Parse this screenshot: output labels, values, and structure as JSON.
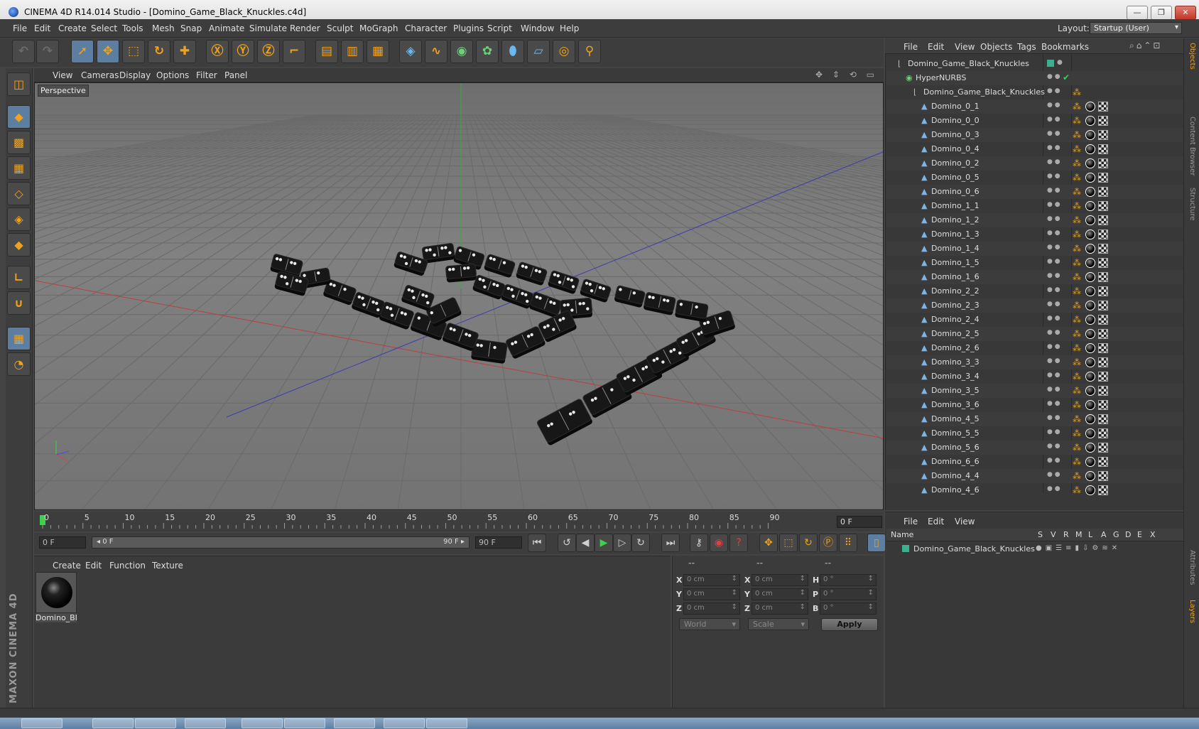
{
  "window": {
    "title": "CINEMA 4D R14.014 Studio - [Domino_Game_Black_Knuckles.c4d]",
    "minimize": "—",
    "maximize": "❐",
    "close": "✕"
  },
  "menu": [
    "File",
    "Edit",
    "Create",
    "Select",
    "Tools",
    "Mesh",
    "Snap",
    "Animate",
    "Simulate",
    "Render",
    "Sculpt",
    "MoGraph",
    "Character",
    "Plugins",
    "Script",
    "Window",
    "Help"
  ],
  "layout": {
    "label": "Layout:",
    "value": "Startup (User)"
  },
  "toolbar": [
    {
      "name": "undo",
      "icon": "undo-icon",
      "glyph": "↶"
    },
    {
      "name": "redo",
      "icon": "redo-icon",
      "glyph": "↷"
    },
    {
      "name": "live-selection",
      "icon": "cursor-icon",
      "glyph": "➚"
    },
    {
      "name": "move",
      "icon": "move-icon",
      "glyph": "✥"
    },
    {
      "name": "scale",
      "icon": "scale-icon",
      "glyph": "⬚"
    },
    {
      "name": "rotate",
      "icon": "rotate-icon",
      "glyph": "↻"
    },
    {
      "name": "create-object",
      "icon": "plus-icon",
      "glyph": "✚"
    },
    {
      "name": "x-axis",
      "icon": "x-axis-icon",
      "glyph": "Ⓧ"
    },
    {
      "name": "y-axis",
      "icon": "y-axis-icon",
      "glyph": "Ⓨ"
    },
    {
      "name": "z-axis",
      "icon": "z-axis-icon",
      "glyph": "Ⓩ"
    },
    {
      "name": "coordinate-system",
      "icon": "coords-icon",
      "glyph": "⌐"
    },
    {
      "name": "render-view",
      "icon": "clapper-icon",
      "glyph": "▤"
    },
    {
      "name": "render-picture-viewer",
      "icon": "clapper-play-icon",
      "glyph": "▥"
    },
    {
      "name": "render-settings",
      "icon": "clapper-gear-icon",
      "glyph": "▦"
    },
    {
      "name": "cube",
      "icon": "cube-icon",
      "glyph": "◈"
    },
    {
      "name": "spline",
      "icon": "spline-icon",
      "glyph": "∿"
    },
    {
      "name": "nurbs",
      "icon": "nurbs-icon",
      "glyph": "◉"
    },
    {
      "name": "array",
      "icon": "mograph-icon",
      "glyph": "✿"
    },
    {
      "name": "deformer",
      "icon": "deformer-icon",
      "glyph": "⬮"
    },
    {
      "name": "floor",
      "icon": "floor-icon",
      "glyph": "▱"
    },
    {
      "name": "camera",
      "icon": "camera-icon",
      "glyph": "◎"
    },
    {
      "name": "light",
      "icon": "light-icon",
      "glyph": "⚲"
    }
  ],
  "lefttools": [
    {
      "name": "make-editable",
      "icon": "make-editable-icon",
      "glyph": "◫"
    },
    {
      "name": "model-mode",
      "icon": "model-icon",
      "glyph": "◆"
    },
    {
      "name": "texture-mode",
      "icon": "checker-icon",
      "glyph": "▩"
    },
    {
      "name": "workplane",
      "icon": "workplane-icon",
      "glyph": "▦"
    },
    {
      "name": "points-mode",
      "icon": "points-icon",
      "glyph": "◇"
    },
    {
      "name": "edges-mode",
      "icon": "edges-icon",
      "glyph": "◈"
    },
    {
      "name": "polygons-mode",
      "icon": "polygons-icon",
      "glyph": "◆"
    },
    {
      "name": "axis-mode",
      "icon": "axis-icon",
      "glyph": "∟"
    },
    {
      "name": "magnet",
      "icon": "magnet-icon",
      "glyph": "∪"
    },
    {
      "name": "grid-lock",
      "icon": "grid-lock-icon",
      "glyph": "▦"
    },
    {
      "name": "snap",
      "icon": "snap-icon",
      "glyph": "◔"
    }
  ],
  "brand": "MAXON CINEMA 4D",
  "viewport": {
    "menu": [
      "View",
      "Cameras",
      "Display",
      "Options",
      "Filter",
      "Panel"
    ],
    "label": "Perspective",
    "nav_icons": "✥ ⇕ ⟲ ▭"
  },
  "timeline": {
    "ticks": [
      "0",
      "5",
      "10",
      "15",
      "20",
      "25",
      "30",
      "35",
      "40",
      "45",
      "50",
      "55",
      "60",
      "65",
      "70",
      "75",
      "80",
      "85",
      "90"
    ],
    "frame_display": "0 F"
  },
  "transport": {
    "start": "0 F",
    "slider_left": "◂ 0 F",
    "slider_right": "90 F ▸",
    "end": "90 F",
    "buttons": [
      {
        "name": "go-start",
        "icon": "go-start-icon",
        "glyph": "⏮"
      },
      {
        "name": "prev-key",
        "icon": "prev-key-icon",
        "glyph": "↺"
      },
      {
        "name": "prev-frame",
        "icon": "prev-frame-icon",
        "glyph": "◀"
      },
      {
        "name": "play",
        "icon": "play-icon",
        "glyph": "▶"
      },
      {
        "name": "next-frame",
        "icon": "next-frame-icon",
        "glyph": "▷"
      },
      {
        "name": "next-key",
        "icon": "next-key-icon",
        "glyph": "↻"
      },
      {
        "name": "go-end",
        "icon": "go-end-icon",
        "glyph": "⏭"
      },
      {
        "name": "record-keys",
        "icon": "key-icon",
        "glyph": "⚷"
      },
      {
        "name": "autokey",
        "icon": "record-icon",
        "glyph": "◉"
      },
      {
        "name": "keyframe-selection",
        "icon": "question-icon",
        "glyph": "?"
      },
      {
        "name": "position-key",
        "icon": "move-icon",
        "glyph": "✥"
      },
      {
        "name": "scale-key",
        "icon": "scale-icon",
        "glyph": "⬚"
      },
      {
        "name": "rotation-key",
        "icon": "rotate-icon",
        "glyph": "↻"
      },
      {
        "name": "param-key",
        "icon": "param-icon",
        "glyph": "Ⓟ"
      },
      {
        "name": "pla-key",
        "icon": "grid-icon",
        "glyph": "⠿"
      },
      {
        "name": "timeline-window",
        "icon": "film-icon",
        "glyph": "▯"
      }
    ]
  },
  "material": {
    "menu": [
      "Create",
      "Edit",
      "Function",
      "Texture"
    ],
    "name": "Domino_Bl"
  },
  "coordinates": {
    "headers": [
      "--",
      "--",
      "--"
    ],
    "rows": [
      {
        "l1": "X",
        "v1": "0 cm",
        "l2": "X",
        "v2": "0 cm",
        "l3": "H",
        "v3": "0 °"
      },
      {
        "l1": "Y",
        "v1": "0 cm",
        "l2": "Y",
        "v2": "0 cm",
        "l3": "P",
        "v3": "0 °"
      },
      {
        "l1": "Z",
        "v1": "0 cm",
        "l2": "Z",
        "v2": "0 cm",
        "l3": "B",
        "v3": "0 °"
      }
    ],
    "space": "World",
    "mode": "Scale",
    "apply": "Apply"
  },
  "objects": {
    "menu": [
      "File",
      "Edit",
      "View",
      "Objects",
      "Tags",
      "Bookmarks"
    ],
    "icons": "⌕⌂⌃⊡",
    "items": [
      {
        "name": "Domino_Game_Black_Knuckles",
        "type": "null",
        "level": 0
      },
      {
        "name": "HyperNURBS",
        "type": "hypernurbs",
        "level": 1
      },
      {
        "name": "Domino_Game_Black_Knuckles",
        "type": "null",
        "level": 2
      },
      {
        "name": "Domino_0_1",
        "type": "poly",
        "level": 3
      },
      {
        "name": "Domino_0_0",
        "type": "poly",
        "level": 3
      },
      {
        "name": "Domino_0_3",
        "type": "poly",
        "level": 3
      },
      {
        "name": "Domino_0_4",
        "type": "poly",
        "level": 3
      },
      {
        "name": "Domino_0_2",
        "type": "poly",
        "level": 3
      },
      {
        "name": "Domino_0_5",
        "type": "poly",
        "level": 3
      },
      {
        "name": "Domino_0_6",
        "type": "poly",
        "level": 3
      },
      {
        "name": "Domino_1_1",
        "type": "poly",
        "level": 3
      },
      {
        "name": "Domino_1_2",
        "type": "poly",
        "level": 3
      },
      {
        "name": "Domino_1_3",
        "type": "poly",
        "level": 3
      },
      {
        "name": "Domino_1_4",
        "type": "poly",
        "level": 3
      },
      {
        "name": "Domino_1_5",
        "type": "poly",
        "level": 3
      },
      {
        "name": "Domino_1_6",
        "type": "poly",
        "level": 3
      },
      {
        "name": "Domino_2_2",
        "type": "poly",
        "level": 3
      },
      {
        "name": "Domino_2_3",
        "type": "poly",
        "level": 3
      },
      {
        "name": "Domino_2_4",
        "type": "poly",
        "level": 3
      },
      {
        "name": "Domino_2_5",
        "type": "poly",
        "level": 3
      },
      {
        "name": "Domino_2_6",
        "type": "poly",
        "level": 3
      },
      {
        "name": "Domino_3_3",
        "type": "poly",
        "level": 3
      },
      {
        "name": "Domino_3_4",
        "type": "poly",
        "level": 3
      },
      {
        "name": "Domino_3_5",
        "type": "poly",
        "level": 3
      },
      {
        "name": "Domino_3_6",
        "type": "poly",
        "level": 3
      },
      {
        "name": "Domino_4_5",
        "type": "poly",
        "level": 3
      },
      {
        "name": "Domino_5_5",
        "type": "poly",
        "level": 3
      },
      {
        "name": "Domino_5_6",
        "type": "poly",
        "level": 3
      },
      {
        "name": "Domino_6_6",
        "type": "poly",
        "level": 3
      },
      {
        "name": "Domino_4_4",
        "type": "poly",
        "level": 3
      },
      {
        "name": "Domino_4_6",
        "type": "poly",
        "level": 3
      }
    ]
  },
  "layers": {
    "menu": [
      "File",
      "Edit",
      "View"
    ],
    "columns": [
      "Name",
      "S",
      "V",
      "R",
      "M",
      "L",
      "A",
      "G",
      "D",
      "E",
      "X"
    ],
    "row": "Domino_Game_Black_Knuckles"
  },
  "right_tabs": [
    {
      "label": "Objects",
      "active": true
    },
    {
      "label": "Content Browser",
      "active": false
    },
    {
      "label": "Structure",
      "active": false
    },
    {
      "label": "Attributes",
      "active": false
    },
    {
      "label": "Layers",
      "active": true
    }
  ],
  "colors": {
    "accent": "#f1a21c",
    "selection": "#5b7ea1",
    "layer": "#3bb08f"
  }
}
